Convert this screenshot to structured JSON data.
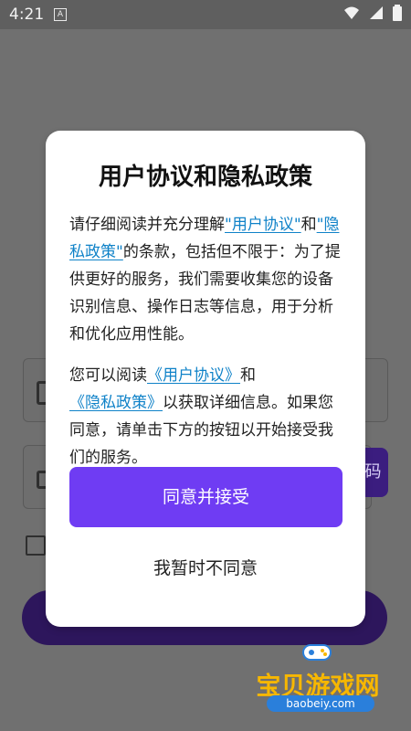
{
  "status_bar": {
    "time": "4:21",
    "left_icon": "A"
  },
  "background": {
    "code_button_text": "码"
  },
  "dialog": {
    "title": "用户协议和隐私政策",
    "p1": {
      "text_before": "请仔细阅读并充分理解",
      "link1": "\"用户协议\"",
      "text_middle": "和",
      "link2": "\"隐私政策\"",
      "text_after": "的条款，包括但不限于：为了提供更好的服务，我们需要收集您的设备识别信息、操作日志等信息，用于分析和优化应用性能。"
    },
    "p2": {
      "text_before": "您可以阅读",
      "link1": "《用户协议》",
      "text_middle": "和",
      "link2": "《隐私政策》",
      "text_after": "以获取详细信息。如果您同意，请单击下方的按钮以开始接受我们的服务。"
    },
    "accept_button": "同意并接受",
    "decline_button": "我暂时不同意"
  },
  "watermark": {
    "title": "宝贝游戏网",
    "url": "baobeiy.com"
  },
  "colors": {
    "primary": "#6f3cf3",
    "link": "#0f82c8",
    "overlay": "#707070",
    "watermark": "#f7b700"
  }
}
